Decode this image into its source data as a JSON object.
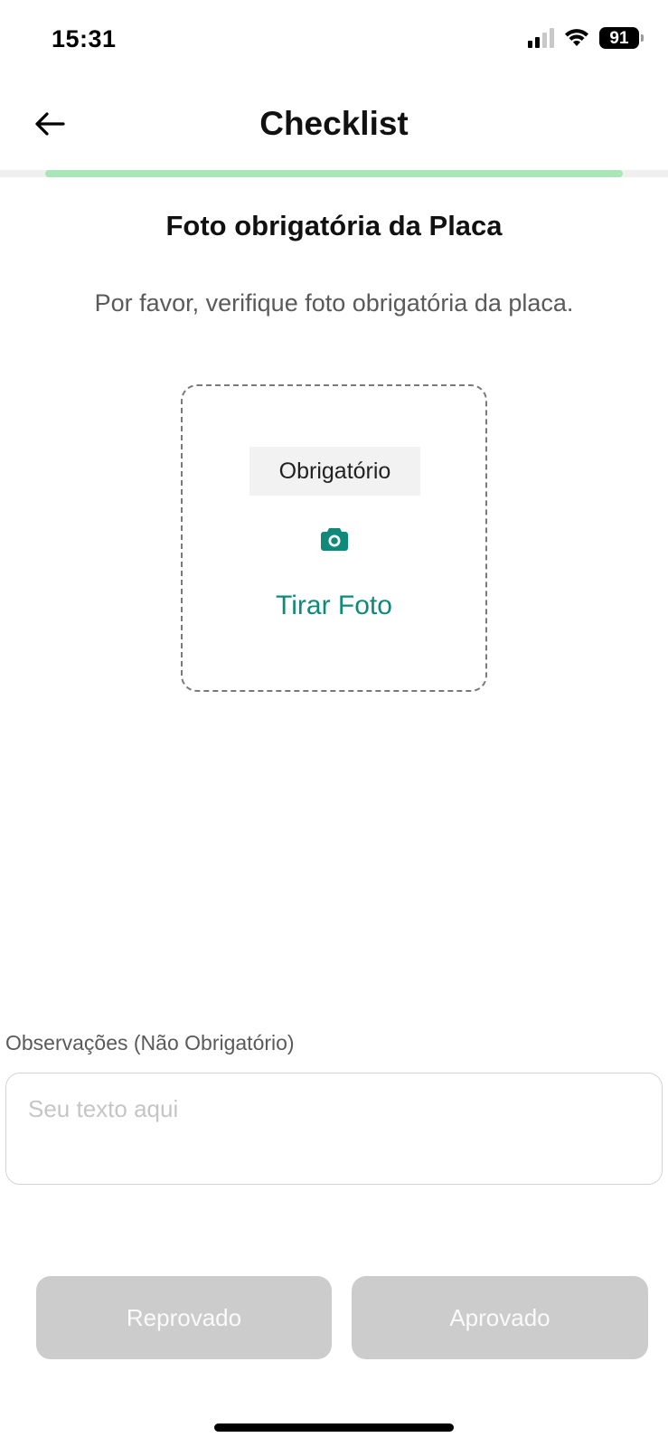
{
  "status_bar": {
    "time": "15:31",
    "battery": "91",
    "icons": [
      "signal-icon",
      "wifi-icon",
      "battery-icon"
    ]
  },
  "header": {
    "title": "Checklist",
    "back_icon": "arrow-left-icon"
  },
  "progress": {
    "fraction": 1.0,
    "color": "#a9e5b6"
  },
  "section": {
    "title": "Foto obrigatória da Placa",
    "description": "Por favor, verifique foto obrigatória da placa."
  },
  "photo": {
    "badge": "Obrigatório",
    "icon": "camera-icon",
    "action_label": "Tirar Foto",
    "accent_color": "#0f8a7a"
  },
  "observations": {
    "label": "Observações (Não Obrigatório)",
    "placeholder": "Seu texto aqui",
    "value": ""
  },
  "actions": {
    "reject_label": "Reprovado",
    "approve_label": "Aprovado",
    "disabled_color": "#cccccc"
  }
}
